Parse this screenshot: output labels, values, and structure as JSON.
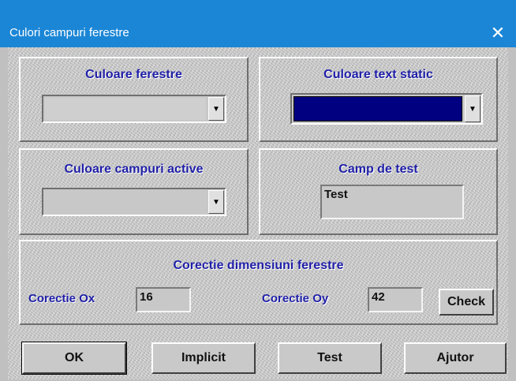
{
  "window": {
    "title": "Culori campuri ferestre",
    "close_glyph": "✕"
  },
  "panels": {
    "culoare_ferestre": {
      "label": "Culoare ferestre"
    },
    "culoare_text_static": {
      "label": "Culoare text static",
      "selected_color": "#000080"
    },
    "culoare_campuri_active": {
      "label": "Culoare campuri active"
    },
    "camp_de_test": {
      "label": "Camp de test",
      "value": "Test"
    }
  },
  "corectie": {
    "heading": "Corectie dimensiuni ferestre",
    "ox_label": "Corectie Ox",
    "ox_value": "16",
    "oy_label": "Corectie Oy",
    "oy_value": "42",
    "check_label": "Check"
  },
  "buttons": {
    "ok": "OK",
    "implicit": "Implicit",
    "test": "Test",
    "ajutor": "Ajutor"
  },
  "icons": {
    "dropdown": "▼"
  }
}
